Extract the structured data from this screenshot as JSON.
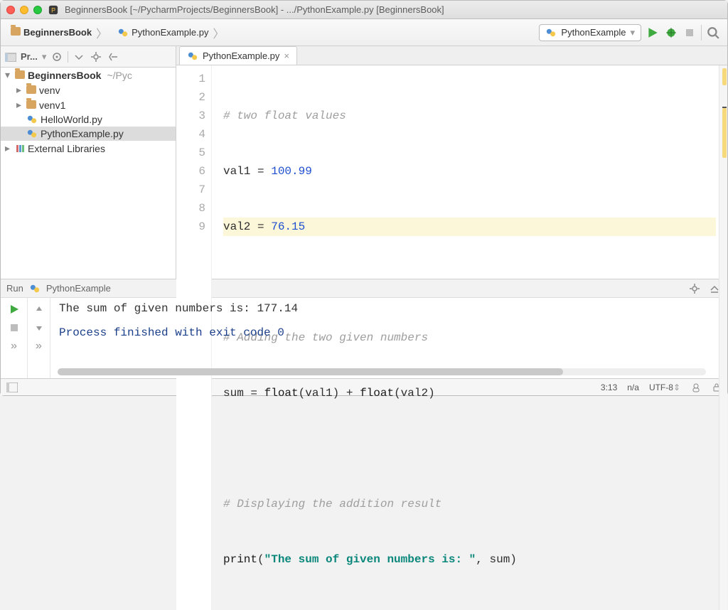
{
  "window": {
    "title": "BeginnersBook [~/PycharmProjects/BeginnersBook] - .../PythonExample.py [BeginnersBook]"
  },
  "breadcrumb": {
    "project": "BeginnersBook",
    "file": "PythonExample.py"
  },
  "run_config": {
    "label": "PythonExample"
  },
  "sidebar": {
    "tab_label": "Pr...",
    "project": {
      "name": "BeginnersBook",
      "path": "~/Pyc"
    },
    "items": [
      {
        "label": "venv",
        "type": "folder"
      },
      {
        "label": "venv1",
        "type": "folder"
      },
      {
        "label": "HelloWorld.py",
        "type": "pyfile"
      },
      {
        "label": "PythonExample.py",
        "type": "pyfile",
        "selected": true
      }
    ],
    "external_libs": "External Libraries"
  },
  "editor": {
    "tab_label": "PythonExample.py",
    "lines": [
      "1",
      "2",
      "3",
      "4",
      "5",
      "6",
      "7",
      "8",
      "9"
    ],
    "code": {
      "l1_comment": "# two float values",
      "l2_var": "val1",
      "l2_eq": " = ",
      "l2_val": "100.99",
      "l3_var": "val2",
      "l3_eq": " = ",
      "l3_val": "76.15",
      "l5_comment": "# Adding the two given numbers",
      "l6_lhs": "sum",
      "l6_eq": " = ",
      "l6_f1": "float",
      "l6_p1": "(val1) + ",
      "l6_f2": "float",
      "l6_p2": "(val2)",
      "l8_comment": "# Displaying the addition result",
      "l9_fn": "print",
      "l9_open": "(",
      "l9_str": "\"The sum of given numbers is: \"",
      "l9_rest": ", sum)"
    }
  },
  "run": {
    "title_prefix": "Run",
    "title_config": "PythonExample",
    "output_line": "The sum of given numbers is:  177.14",
    "exit_line": "Process finished with exit code 0"
  },
  "status": {
    "cursor": "3:13",
    "insert": "n/a",
    "encoding": "UTF-8",
    "encoding_arrow": "⇕"
  }
}
